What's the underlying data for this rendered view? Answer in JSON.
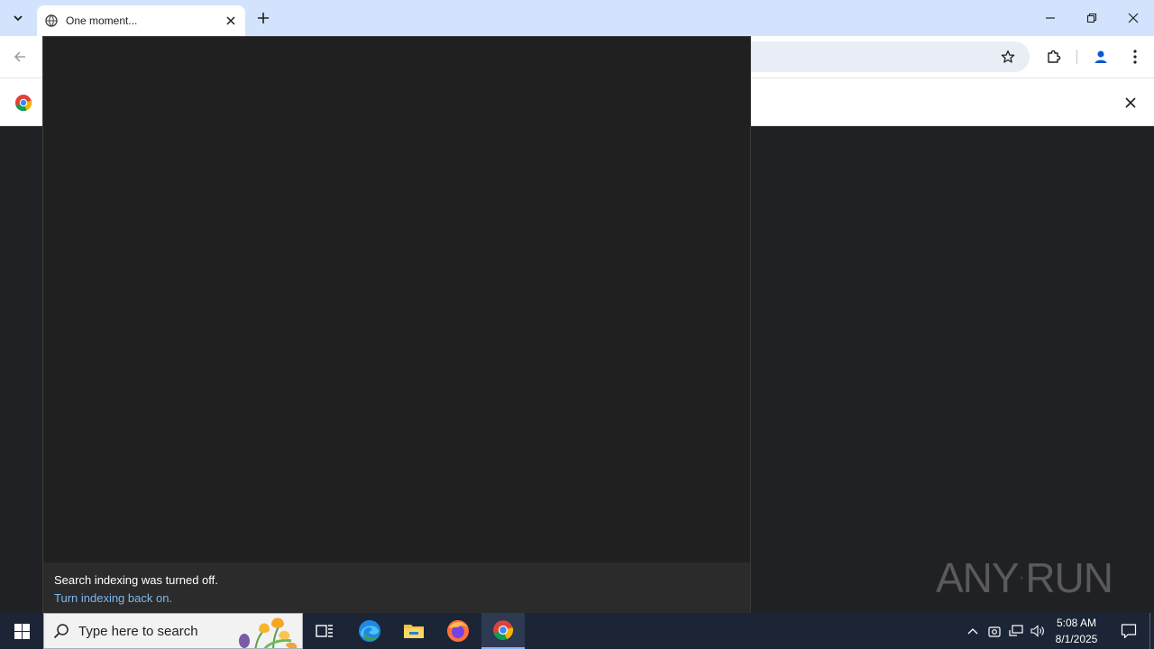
{
  "browser": {
    "tab": {
      "title": "One moment..."
    },
    "icons": {
      "tab_search": "chevron-down-icon",
      "favicon": "globe-icon",
      "close": "close-icon",
      "new_tab": "plus-icon",
      "back": "arrow-left-icon",
      "bookmark": "star-icon",
      "extensions": "puzzle-icon",
      "profile": "person-icon",
      "menu": "kebab-icon"
    },
    "colors": {
      "tabstrip": "#d3e3fd",
      "toolbar": "#ffffff",
      "omnibox": "#e9eef6"
    }
  },
  "search_flyout": {
    "footer_message": "Search indexing was turned off.",
    "footer_link": "Turn indexing back on."
  },
  "watermark": {
    "text_left": "ANY",
    "text_right": "RUN"
  },
  "taskbar": {
    "search_placeholder": "Type here to search",
    "apps": [
      "task-view",
      "edge",
      "file-explorer",
      "firefox",
      "chrome"
    ],
    "active_app": "chrome",
    "clock": {
      "time": "5:08 AM",
      "date": "8/1/2025"
    }
  }
}
